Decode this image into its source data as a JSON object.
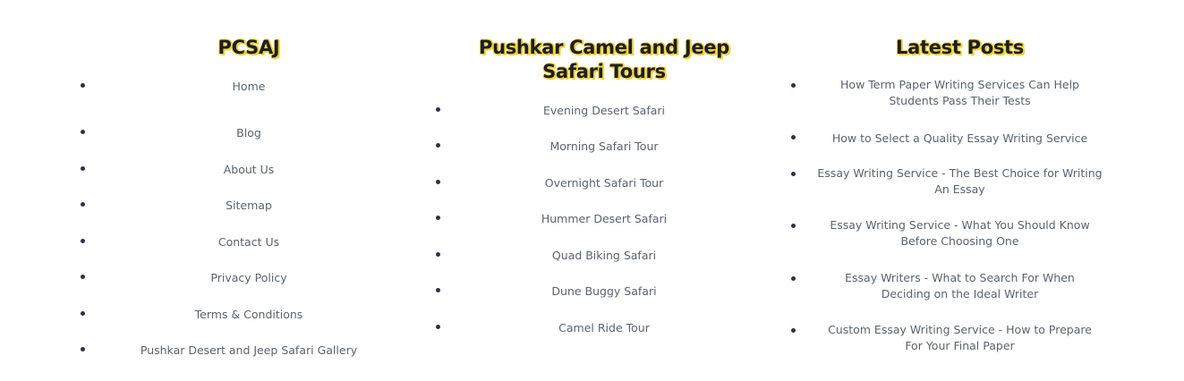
{
  "columns": [
    {
      "title": "PCSAJ",
      "items": [
        "Home",
        "Blog",
        "About Us",
        "Sitemap",
        "Contact Us",
        "Privacy Policy",
        "Terms & Conditions",
        "Pushkar Desert and Jeep Safari Gallery"
      ]
    },
    {
      "title": "Pushkar Camel and Jeep Safari Tours",
      "items": [
        "Evening Desert Safari",
        "Morning Safari Tour",
        "Overnight Safari Tour",
        "Hummer Desert Safari",
        "Quad Biking Safari",
        "Dune Buggy Safari",
        "Camel Ride Tour"
      ]
    },
    {
      "title": "Latest Posts",
      "items": [
        "How Term Paper Writing Services Can Help Students Pass Their Tests",
        "How to Select a Quality Essay Writing Service",
        "Essay Writing Service - The Best Choice for Writing An Essay",
        "Essay Writing Service - What You Should Know Before Choosing One",
        "Essay Writers - What to Search For When Deciding on the Ideal Writer",
        "Custom Essay Writing Service - How to Prepare For Your Final Paper"
      ]
    }
  ]
}
